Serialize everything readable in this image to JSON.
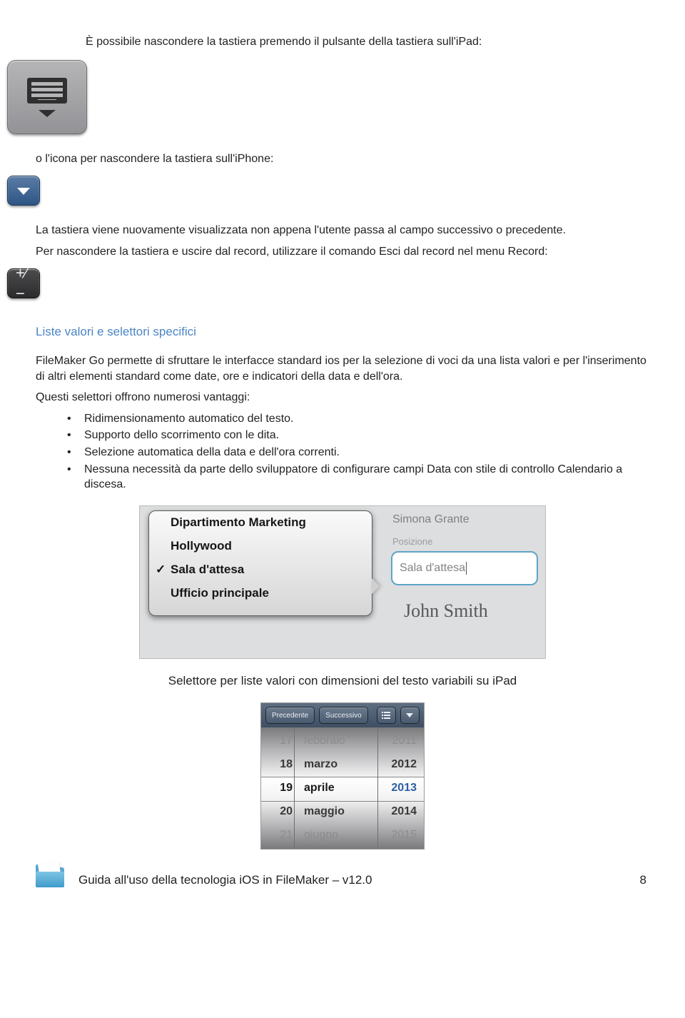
{
  "para1": "È possibile nascondere la tastiera premendo il pulsante della tastiera sull'iPad:",
  "para2": "o l'icona per nascondere la tastiera sull'iPhone:",
  "para3": "La tastiera viene nuovamente visualizzata non appena l'utente passa al campo successivo o precedente.",
  "para4": "Per nascondere la tastiera e uscire dal record, utilizzare il comando Esci dal record nel menu Record:",
  "section_heading": "Liste valori e selettori specifici",
  "para5": "FileMaker Go permette di sfruttare le interfacce standard ios per la selezione di voci da una lista valori e per l'inserimento di altri elementi standard come date, ore e indicatori della data e dell'ora.",
  "para6": "Questi selettori offrono numerosi vantaggi:",
  "bullets": [
    "Ridimensionamento automatico del testo.",
    "Supporto dello scorrimento con le dita.",
    "Selezione automatica della data e dell'ora correnti.",
    "Nessuna necessità da parte dello sviluppatore di configurare campi Data con stile di controllo Calendario a discesa."
  ],
  "figure1": {
    "options": [
      "Dipartimento Marketing",
      "Hollywood",
      "Sala d'attesa",
      "Ufficio principale"
    ],
    "selected_index": 2,
    "name": "Simona Grante",
    "field_label": "Posizione",
    "field_value": "Sala d'attesa",
    "signature": "John Smith"
  },
  "caption1": "Selettore per liste valori con dimensioni del testo variabili su iPad",
  "figure2": {
    "prev": "Precedente",
    "next": "Successivo",
    "rows": [
      {
        "day": "17",
        "month": "febbraio",
        "year": "2011",
        "faded": true
      },
      {
        "day": "18",
        "month": "marzo",
        "year": "2012",
        "sel": true
      },
      {
        "day": "19",
        "month": "aprile",
        "year": "2013",
        "faded": true
      },
      {
        "day": "20",
        "month": "maggio",
        "year": "2014",
        "faded": false
      },
      {
        "day": "21",
        "month": "giugno",
        "year": "2015",
        "faded": true
      }
    ]
  },
  "footer_title": "Guida all'uso della tecnologia iOS in FileMaker – v12.0",
  "page_number": "8"
}
